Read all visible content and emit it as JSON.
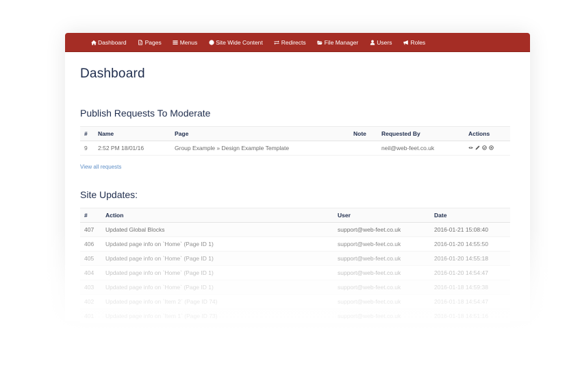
{
  "navbar": {
    "brand_color": "#a52d25",
    "items": [
      {
        "label": "Dashboard",
        "icon": "home-icon"
      },
      {
        "label": "Pages",
        "icon": "file-icon"
      },
      {
        "label": "Menus",
        "icon": "bars-icon"
      },
      {
        "label": "Site Wide Content",
        "icon": "globe-icon"
      },
      {
        "label": "Redirects",
        "icon": "exchange-icon"
      },
      {
        "label": "File Manager",
        "icon": "folder-open-icon"
      },
      {
        "label": "Users",
        "icon": "user-icon"
      },
      {
        "label": "Roles",
        "icon": "bullhorn-icon"
      }
    ]
  },
  "page": {
    "title": "Dashboard"
  },
  "publish_requests": {
    "title": "Publish Requests To Moderate",
    "columns": [
      "#",
      "Name",
      "Page",
      "Note",
      "Requested By",
      "Actions"
    ],
    "rows": [
      {
        "id": "9",
        "name": "2:52 PM 18/01/16",
        "page": "Group Example » Design Example Template",
        "note": "",
        "requested_by": "neil@web-feet.co.uk",
        "actions": [
          "eye-icon",
          "pencil-icon",
          "check-circle-icon",
          "times-circle-icon"
        ]
      }
    ],
    "view_all_label": "View all requests"
  },
  "site_updates": {
    "title": "Site Updates:",
    "columns": [
      "#",
      "Action",
      "User",
      "Date"
    ],
    "rows": [
      {
        "id": "407",
        "action": "Updated Global Blocks",
        "user": "support@web-feet.co.uk",
        "date": "2016-01-21 15:08:40"
      },
      {
        "id": "406",
        "action": "Updated page info on `Home` (Page ID 1)",
        "user": "support@web-feet.co.uk",
        "date": "2016-01-20 14:55:50"
      },
      {
        "id": "405",
        "action": "Updated page info on `Home` (Page ID 1)",
        "user": "support@web-feet.co.uk",
        "date": "2016-01-20 14:55:18"
      },
      {
        "id": "404",
        "action": "Updated page info on `Home` (Page ID 1)",
        "user": "support@web-feet.co.uk",
        "date": "2016-01-20 14:54:47"
      },
      {
        "id": "403",
        "action": "Updated page info on `Home` (Page ID 1)",
        "user": "support@web-feet.co.uk",
        "date": "2016-01-18 14:59:38"
      },
      {
        "id": "402",
        "action": "Updated page info on `Item 2` (Page ID 74)",
        "user": "support@web-feet.co.uk",
        "date": "2016-01-18 14:54:47"
      },
      {
        "id": "401",
        "action": "Updated page info on `Item 1` (Page ID 73)",
        "user": "support@web-feet.co.uk",
        "date": "2016-01-18 14:51:16"
      }
    ]
  }
}
